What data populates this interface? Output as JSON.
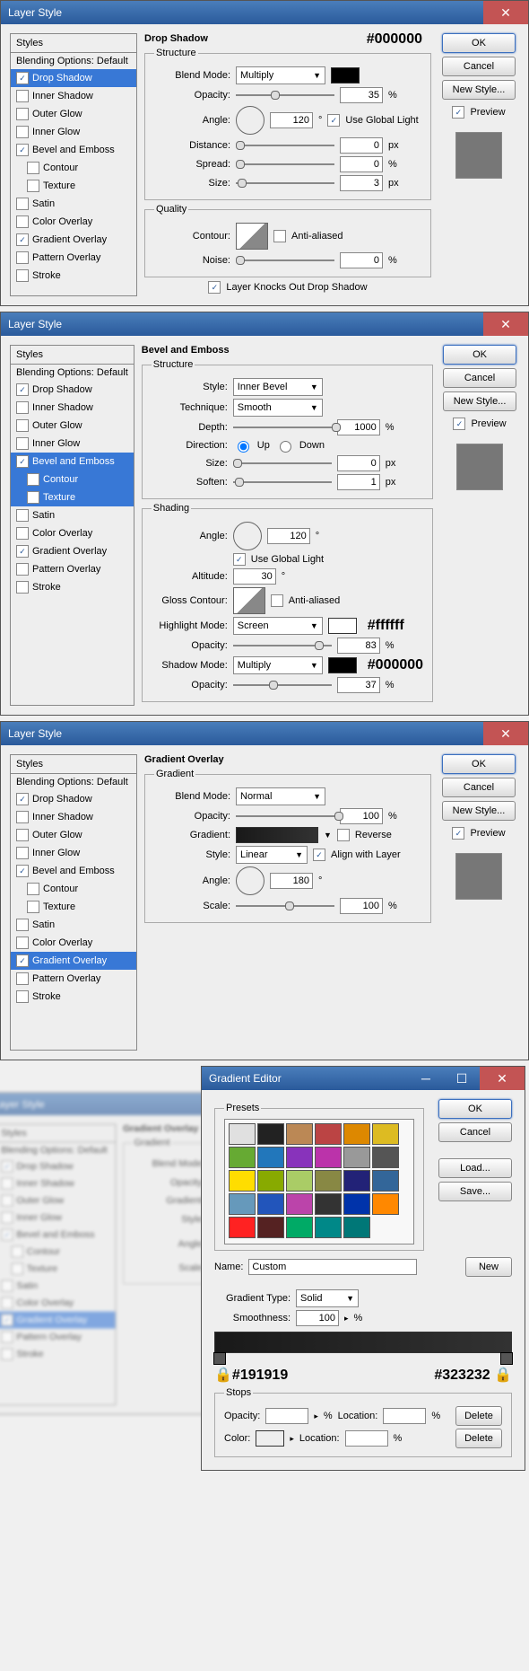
{
  "windows": [
    {
      "title": "Layer Style",
      "section": "Drop Shadow",
      "annot": "#000000",
      "swatch": "#000000",
      "styles": {
        "head": "Styles",
        "blend": "Blending Options: Default",
        "items": [
          {
            "label": "Drop Shadow",
            "checked": true,
            "sel": true
          },
          {
            "label": "Inner Shadow",
            "checked": false
          },
          {
            "label": "Outer Glow",
            "checked": false
          },
          {
            "label": "Inner Glow",
            "checked": false
          },
          {
            "label": "Bevel and Emboss",
            "checked": true
          },
          {
            "label": "Contour",
            "checked": false,
            "sub": true
          },
          {
            "label": "Texture",
            "checked": false,
            "sub": true
          },
          {
            "label": "Satin",
            "checked": false
          },
          {
            "label": "Color Overlay",
            "checked": false
          },
          {
            "label": "Gradient Overlay",
            "checked": true
          },
          {
            "label": "Pattern Overlay",
            "checked": false
          },
          {
            "label": "Stroke",
            "checked": false
          }
        ]
      },
      "fields": {
        "blendMode": "Multiply",
        "opacity": "35",
        "angle": "120",
        "useGlobal": true,
        "distance": "0",
        "spread": "0",
        "size": "3",
        "antialiased": false,
        "noise": "0",
        "knocks": true,
        "knocksLabel": "Layer Knocks Out Drop Shadow"
      }
    },
    {
      "title": "Layer Style",
      "section": "Bevel and Emboss",
      "styles": {
        "head": "Styles",
        "blend": "Blending Options: Default",
        "items": [
          {
            "label": "Drop Shadow",
            "checked": true
          },
          {
            "label": "Inner Shadow",
            "checked": false
          },
          {
            "label": "Outer Glow",
            "checked": false
          },
          {
            "label": "Inner Glow",
            "checked": false
          },
          {
            "label": "Bevel and Emboss",
            "checked": true,
            "sel": true
          },
          {
            "label": "Contour",
            "checked": false,
            "sub": true,
            "sel": true
          },
          {
            "label": "Texture",
            "checked": false,
            "sub": true,
            "sel": true
          },
          {
            "label": "Satin",
            "checked": false
          },
          {
            "label": "Color Overlay",
            "checked": false
          },
          {
            "label": "Gradient Overlay",
            "checked": true
          },
          {
            "label": "Pattern Overlay",
            "checked": false
          },
          {
            "label": "Stroke",
            "checked": false
          }
        ]
      },
      "structure": {
        "style": "Inner Bevel",
        "technique": "Smooth",
        "depth": "1000",
        "direction": "Up",
        "size": "0",
        "soften": "1"
      },
      "shading": {
        "angle": "120",
        "useGlobal": true,
        "altitude": "30",
        "antialiased": false,
        "hmode": "Screen",
        "hcolor": "#ffffff",
        "hopacity": "83",
        "smode": "Multiply",
        "scolor": "#000000",
        "sopacity": "37"
      },
      "annotH": "#ffffff",
      "annotS": "#000000"
    },
    {
      "title": "Layer Style",
      "section": "Gradient Overlay",
      "styles": {
        "head": "Styles",
        "blend": "Blending Options: Default",
        "items": [
          {
            "label": "Drop Shadow",
            "checked": true
          },
          {
            "label": "Inner Shadow",
            "checked": false
          },
          {
            "label": "Outer Glow",
            "checked": false
          },
          {
            "label": "Inner Glow",
            "checked": false
          },
          {
            "label": "Bevel and Emboss",
            "checked": true
          },
          {
            "label": "Contour",
            "checked": false,
            "sub": true
          },
          {
            "label": "Texture",
            "checked": false,
            "sub": true
          },
          {
            "label": "Satin",
            "checked": false
          },
          {
            "label": "Color Overlay",
            "checked": false
          },
          {
            "label": "Gradient Overlay",
            "checked": true,
            "sel": true
          },
          {
            "label": "Pattern Overlay",
            "checked": false
          },
          {
            "label": "Stroke",
            "checked": false
          }
        ]
      },
      "grad": {
        "blendMode": "Normal",
        "opacity": "100",
        "reverse": false,
        "style": "Linear",
        "align": true,
        "angle": "180",
        "scale": "100"
      }
    }
  ],
  "right": {
    "ok": "OK",
    "cancel": "Cancel",
    "newstyle": "New Style...",
    "preview": "Preview"
  },
  "labels": {
    "blendMode": "Blend Mode:",
    "opacity": "Opacity:",
    "angle": "Angle:",
    "useGlobal": "Use Global Light",
    "distance": "Distance:",
    "spread": "Spread:",
    "size": "Size:",
    "contour": "Contour:",
    "anti": "Anti-aliased",
    "noise": "Noise:",
    "structure": "Structure",
    "quality": "Quality",
    "shading": "Shading",
    "style": "Style:",
    "technique": "Technique:",
    "depth": "Depth:",
    "direction": "Direction:",
    "up": "Up",
    "down": "Down",
    "soften": "Soften:",
    "altitude": "Altitude:",
    "gloss": "Gloss Contour:",
    "hmode": "Highlight Mode:",
    "smode": "Shadow Mode:",
    "gradient": "Gradient",
    "gradientc": "Gradient:",
    "reverse": "Reverse",
    "align": "Align with Layer",
    "scale": "Scale:",
    "pct": "%",
    "px": "px",
    "deg": "°"
  },
  "editor": {
    "title": "Gradient Editor",
    "presets": "Presets",
    "name": "Name:",
    "nameVal": "Custom",
    "new": "New",
    "type": "Gradient Type:",
    "typeVal": "Solid",
    "smooth": "Smoothness:",
    "smoothVal": "100",
    "stops": "Stops",
    "opacityL": "Opacity:",
    "locationL": "Location:",
    "delete": "Delete",
    "colorL": "Color:",
    "load": "Load...",
    "save": "Save...",
    "ok": "OK",
    "cancel": "Cancel",
    "left": "#191919",
    "right": "#323232",
    "colors": [
      "#e0e0e0",
      "#222",
      "#b85",
      "#b44",
      "#d80",
      "#db2",
      "#6a3",
      "#27b",
      "#83b",
      "#b3a",
      "#999",
      "#555",
      "#fd0",
      "#8a0",
      "#ac6",
      "#884",
      "#227",
      "#369",
      "#69b",
      "#25b",
      "#b4a",
      "#333",
      "#03a",
      "#f80",
      "#f22",
      "#522",
      "#0a6",
      "#088",
      "#077"
    ]
  }
}
